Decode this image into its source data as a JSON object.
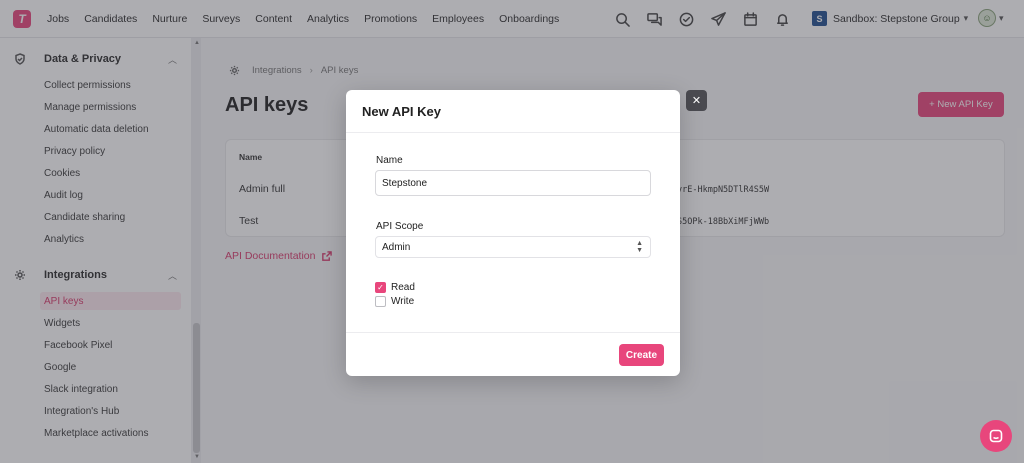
{
  "app": {
    "logo_letter": "T",
    "brand_color": "#e8467c"
  },
  "nav": [
    "Jobs",
    "Candidates",
    "Nurture",
    "Surveys",
    "Content",
    "Analytics",
    "Promotions",
    "Employees",
    "Onboardings"
  ],
  "account": {
    "badge": "S",
    "name": "Sandbox: Stepstone Group"
  },
  "sidebar": {
    "data_privacy": {
      "title": "Data & Privacy",
      "items": [
        "Collect permissions",
        "Manage permissions",
        "Automatic data deletion",
        "Privacy policy",
        "Cookies",
        "Audit log",
        "Candidate sharing",
        "Analytics"
      ]
    },
    "integrations": {
      "title": "Integrations",
      "items": [
        "API keys",
        "Widgets",
        "Facebook Pixel",
        "Google",
        "Slack integration",
        "Integration's Hub",
        "Marketplace activations"
      ]
    }
  },
  "main": {
    "breadcrumb": [
      "Integrations",
      "API keys"
    ],
    "title": "API keys",
    "new_button": "+ New API Key",
    "table": {
      "header": "Name",
      "rows": [
        {
          "name": "Admin full",
          "key": "vrE-HkmpN5DTlR4S5W"
        },
        {
          "name": "Test",
          "key": "S5OPk-18BbXiMFjWWb"
        }
      ]
    },
    "api_doc_link": "API Documentation"
  },
  "modal": {
    "title": "New API Key",
    "name_label": "Name",
    "name_value": "Stepstone",
    "scope_label": "API Scope",
    "scope_value": "Admin",
    "checkboxes": [
      {
        "label": "Read",
        "checked": true
      },
      {
        "label": "Write",
        "checked": false
      }
    ],
    "create_button": "Create",
    "close_symbol": "✕"
  }
}
